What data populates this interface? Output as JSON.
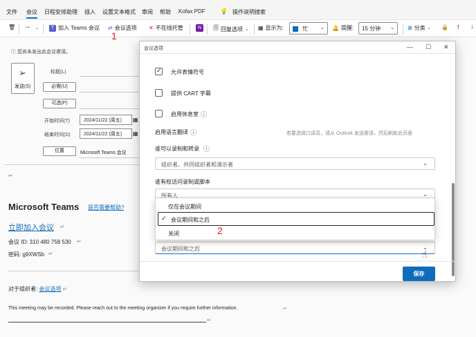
{
  "menu": {
    "items": [
      "文件",
      "会议",
      "日程安排助理",
      "插入",
      "设置文本格式",
      "审阅",
      "帮助",
      "Kofax PDF"
    ],
    "search_placeholder": "操作说明搜索"
  },
  "ribbon": {
    "join_teams": "加入 Teams 会议",
    "meeting_options": "会议选项",
    "not_online": "不在线托管",
    "reply_options": "回复选项",
    "show_as_label": "显示为:",
    "show_as_value": "忙",
    "reminder_label": "提醒:",
    "reminder_value": "15 分钟",
    "categorize": "分类"
  },
  "compose": {
    "info": "您尚未发出此会议邀请。",
    "send": "发送(S)",
    "title_label": "标题(L)",
    "required": "必需(U)",
    "optional": "可选(P)",
    "start_label": "开始时间(T)",
    "end_label": "结束时间(D)",
    "start_date": "2024/11/22 (周五)",
    "end_date": "2024/11/22 (周五)",
    "location_btn": "位置",
    "location_value": "Microsoft Teams 会议",
    "teams_heading": "Microsoft Teams",
    "need_help": "是否需要帮助?",
    "join_now": "立即加入会议",
    "meeting_id": "会议 ID: 310 480 758 530",
    "passcode": "密码: g9XWSb",
    "organizer_prefix": "对于组织者: ",
    "organizer_link": "会议选项",
    "recorded_note": "This meeting may be recorded. Please reach out to the meeting organizer if you require further information."
  },
  "dialog": {
    "title": "会议选项",
    "allow_emoji": "允许表情符号",
    "cart": "提供 CART 字幕",
    "green_room": "启用休息室",
    "language": "启用语言翻译",
    "language_hint": "若要选择口译员，请从 Outlook 发送邀请，然后刷新此页面",
    "who_record": "谁可以录制和转录",
    "who_record_value": "组织者、共同组织者和演示者",
    "who_access": "谁有权访问录制或脚本",
    "who_access_value": "所有人",
    "options": [
      "仅在会议期间",
      "会议期间和之后",
      "关闭"
    ],
    "selected_value": "会议期间和之后",
    "save": "保存"
  },
  "annotations": {
    "one": "1",
    "two": "2"
  }
}
